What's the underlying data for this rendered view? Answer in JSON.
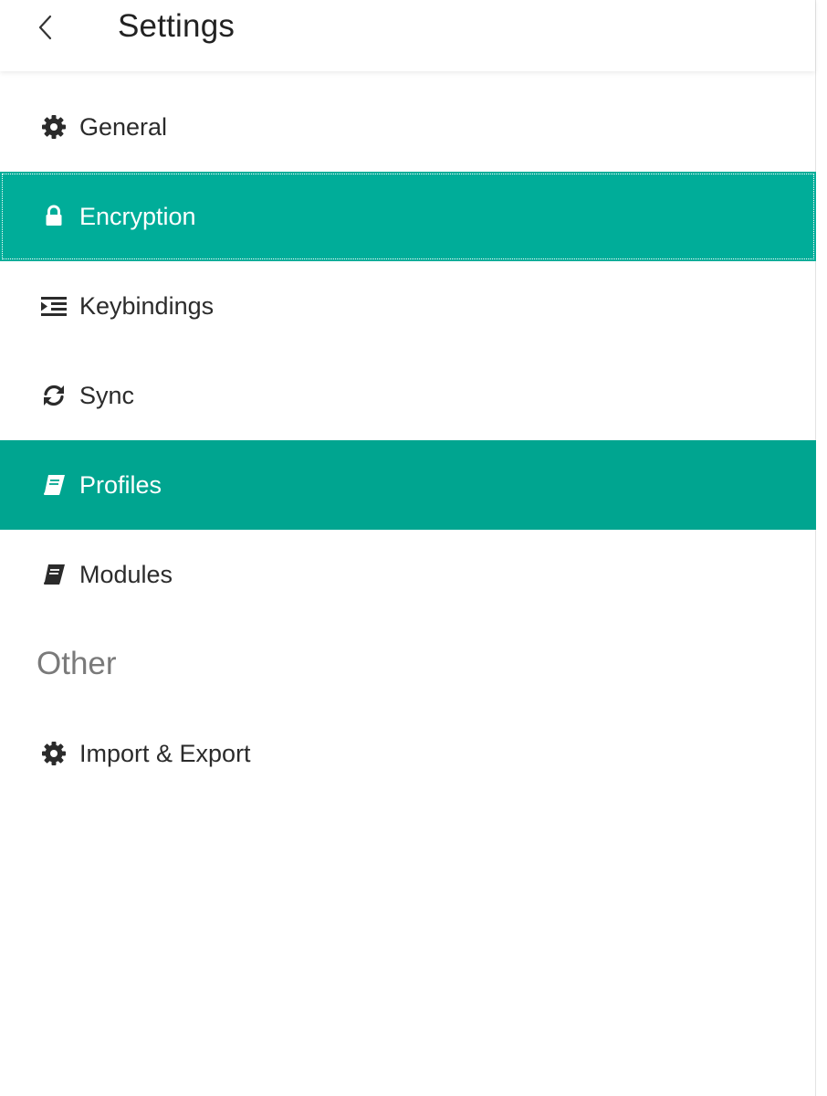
{
  "header": {
    "title": "Settings",
    "back_icon": "chevron-left-icon"
  },
  "colors": {
    "accent": "#00ad99",
    "accent_active": "#00a590",
    "text": "#2b2b2b",
    "muted": "#7a7a7a"
  },
  "nav": {
    "items": [
      {
        "label": "General",
        "icon": "gear-icon",
        "state": "default"
      },
      {
        "label": "Encryption",
        "icon": "lock-icon",
        "state": "focused"
      },
      {
        "label": "Keybindings",
        "icon": "indent-icon",
        "state": "default"
      },
      {
        "label": "Sync",
        "icon": "sync-icon",
        "state": "default"
      },
      {
        "label": "Profiles",
        "icon": "book-icon",
        "state": "active"
      },
      {
        "label": "Modules",
        "icon": "book-icon",
        "state": "default"
      }
    ]
  },
  "other": {
    "heading": "Other",
    "items": [
      {
        "label": "Import & Export",
        "icon": "gear-icon",
        "state": "default"
      }
    ]
  }
}
